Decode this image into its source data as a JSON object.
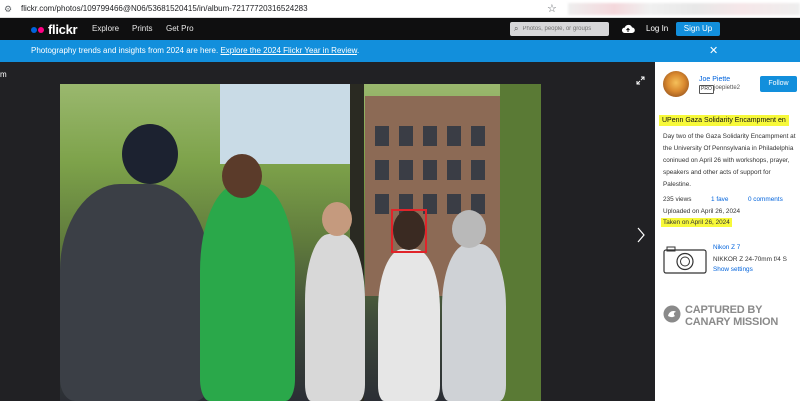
{
  "browser": {
    "url": "flickr.com/photos/109799466@N06/53681520415/in/album-72177720316524283"
  },
  "nav": {
    "logo_text": "flickr",
    "links": [
      "Explore",
      "Prints",
      "Get Pro"
    ],
    "search_placeholder": "Photos, people, or groups",
    "login_label": "Log In",
    "signup_label": "Sign Up"
  },
  "banner": {
    "text": "Photography trends and insights from 2024 are here. ",
    "link_text": "Explore the 2024 Flickr Year in Review",
    "text_end": "."
  },
  "stage": {
    "edge_label": "m"
  },
  "author": {
    "name": "Joe Piette",
    "pro_badge": "PRO",
    "username": "joepiette2",
    "follow_label": "Follow"
  },
  "photo": {
    "title": "UPenn Gaza Solidarity Encampment en",
    "description": "Day two of the Gaza Solidarity Encampment at the University Of Pennsylvania in Philadelphia coninued on April 26 with workshops, prayer, speakers and other acts of support for Palestine."
  },
  "stats": {
    "views": "235 views",
    "faves": "1 fave",
    "comments": "0 comments",
    "uploaded": "Uploaded on April 26, 2024",
    "taken": "Taken on April 26, 2024"
  },
  "camera": {
    "make": "Nikon Z 7",
    "lens": "NIKKOR Z 24-70mm f/4 S",
    "settings_label": "Show settings"
  },
  "watermark": {
    "line1": "CAPTURED BY",
    "line2": "CANARY MISSION"
  },
  "colors": {
    "flickr_blue": "#0063dc",
    "flickr_pink": "#ff0084",
    "button_blue": "#128fdc",
    "highlight": "#f7f93a",
    "annotation_red": "#e0242a"
  }
}
